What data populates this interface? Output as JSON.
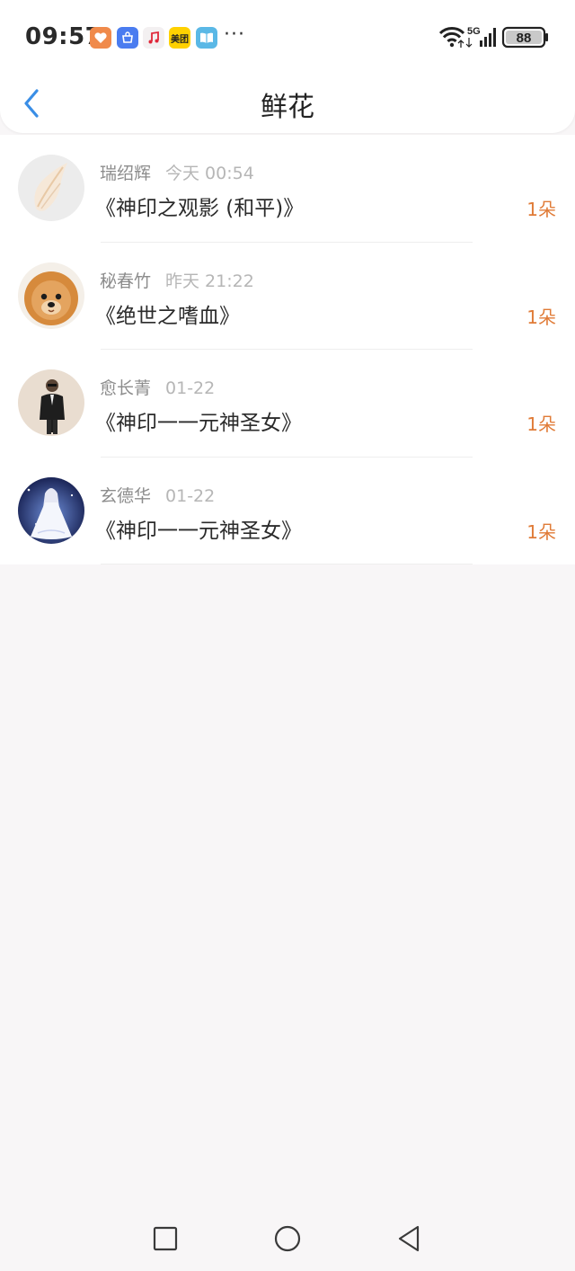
{
  "status_bar": {
    "time": "09:57",
    "more": "···",
    "signal_label": "5G",
    "battery": "88",
    "apps": [
      {
        "icon": "heart-app-icon",
        "color": "#f08a4b"
      },
      {
        "icon": "vivo-store-app-icon",
        "color": "#4a7cf0"
      },
      {
        "icon": "music-app-icon",
        "color": "#f3f0f1"
      },
      {
        "icon": "meituan-app-icon",
        "color": "#ffd100",
        "label": "美团"
      },
      {
        "icon": "book-app-icon",
        "color": "#5ab8e6"
      }
    ]
  },
  "header": {
    "title": "鲜花",
    "back_icon": "chevron-left-icon"
  },
  "list": {
    "items": [
      {
        "name": "瑞绍辉",
        "time": "今天 00:54",
        "book": "《神印之观影 (和平)》",
        "count": "1朵",
        "avatar": "shell-avatar"
      },
      {
        "name": "秘春竹",
        "time": "昨天 21:22",
        "book": "《绝世之嗜血》",
        "count": "1朵",
        "avatar": "puppy-avatar"
      },
      {
        "name": "愈长菁",
        "time": "01-22",
        "book": "《神印一一元神圣女》",
        "count": "1朵",
        "avatar": "man-avatar"
      },
      {
        "name": "玄德华",
        "time": "01-22",
        "book": "《神印一一元神圣女》",
        "count": "1朵",
        "avatar": "anime-girl-avatar"
      }
    ]
  },
  "colors": {
    "accent": "#3a8ee6",
    "count": "#e07b37",
    "background": "#f8f6f7"
  },
  "nav": {
    "recent_icon": "square-icon",
    "home_icon": "circle-icon",
    "back_icon": "triangle-back-icon"
  }
}
